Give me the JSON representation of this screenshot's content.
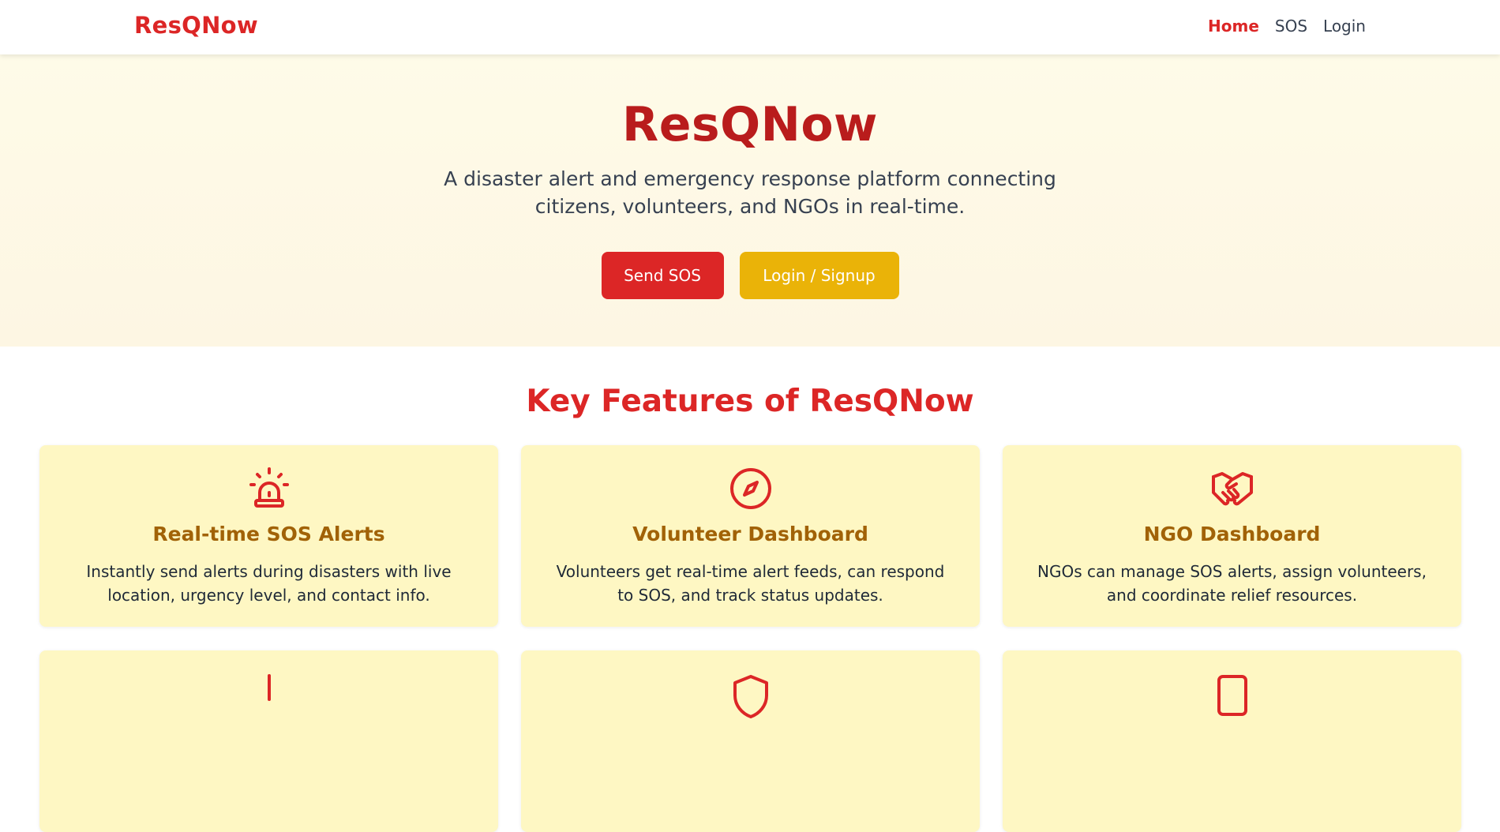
{
  "nav": {
    "brand": "ResQNow",
    "links": [
      {
        "label": "Home",
        "active": true
      },
      {
        "label": "SOS",
        "active": false
      },
      {
        "label": "Login",
        "active": false
      }
    ]
  },
  "hero": {
    "title": "ResQNow",
    "subtitle": "A disaster alert and emergency response platform connecting citizens, volunteers, and NGOs in real-time.",
    "sos_button": "Send SOS",
    "login_button": "Login / Signup"
  },
  "features": {
    "title": "Key Features of ResQNow",
    "cards": [
      {
        "icon": "siren-icon",
        "title": "Real-time SOS Alerts",
        "desc": "Instantly send alerts during disasters with live location, urgency level, and contact info."
      },
      {
        "icon": "compass-icon",
        "title": "Volunteer Dashboard",
        "desc": "Volunteers get real-time alert feeds, can respond to SOS, and track status updates."
      },
      {
        "icon": "handshake-icon",
        "title": "NGO Dashboard",
        "desc": "NGOs can manage SOS alerts, assign volunteers, and coordinate relief resources."
      },
      {
        "icon": "pin-icon"
      },
      {
        "icon": "shield-icon"
      },
      {
        "icon": "device-icon"
      }
    ]
  },
  "colors": {
    "brand_red": "#dc2626",
    "hero_title_red": "#b91c1c",
    "accent_yellow": "#eab308",
    "card_bg": "#fef7c3",
    "card_title": "#a16207"
  }
}
